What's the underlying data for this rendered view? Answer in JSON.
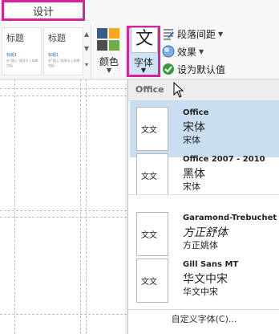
{
  "ribbon": {
    "tab_label": "设计",
    "themes": [
      {
        "title": "标题",
        "line1": "标题1",
        "line2": "在\"插入\"选项卡上的库包括"
      },
      {
        "title": "标题",
        "line1": "标题1",
        "line2": "在\"插入\"选项卡上的库包括"
      }
    ],
    "colors_label": "颜色",
    "fonts_glyph": "文",
    "fonts_label": "字体",
    "paragraph_spacing_label": "段落间距",
    "effects_label": "效果",
    "set_default_label": "设为默认值",
    "swatch_colors": [
      "#3a5a8c",
      "#f5a623",
      "#4d4d4d",
      "#70ad47"
    ]
  },
  "fonts_panel": {
    "header": "Office",
    "preview_glyph": "文文",
    "items": [
      {
        "name": "Office",
        "heading": "宋体",
        "body": "宋体",
        "selected": true
      },
      {
        "name": "Office 2007 - 2010",
        "heading": "黑体",
        "body": "宋体",
        "selected": false
      },
      {
        "name": "Garamond-Trebuchet",
        "heading": "方正舒体",
        "body": "方正姚体",
        "selected": false
      },
      {
        "name": "Gill Sans MT",
        "heading": "华文中宋",
        "body": "华文中宋",
        "selected": false
      }
    ],
    "custom_label": "自定义字体(C)..."
  }
}
